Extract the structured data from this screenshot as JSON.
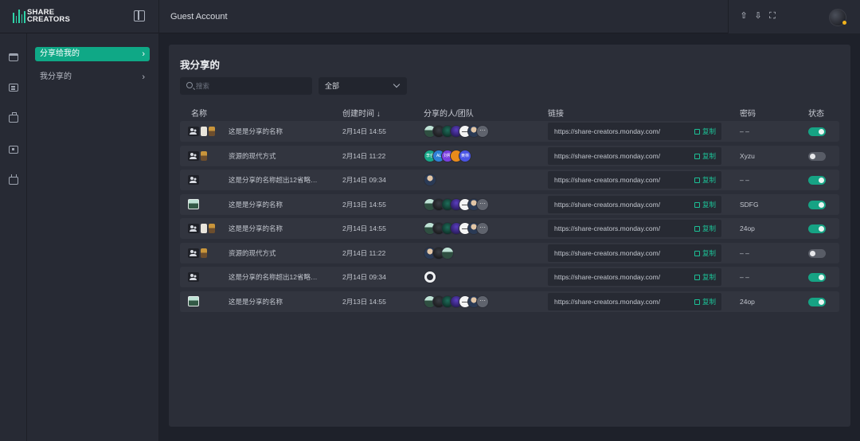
{
  "brand": {
    "line1": "SHARE",
    "line2": "CREATORS"
  },
  "header": {
    "account": "Guest Account"
  },
  "nav": {
    "items": [
      {
        "label": "分享给我的",
        "active": true
      },
      {
        "label": "我分享的",
        "active": false
      }
    ]
  },
  "main": {
    "title": "我分享的",
    "search_placeholder": "搜索",
    "filter_value": "全部",
    "columns": {
      "name": "名称",
      "created": "创建时间 ↓",
      "shared_with": "分享的人/团队",
      "link": "链接",
      "password": "密码",
      "status": "状态"
    },
    "copy_label": "复制",
    "avatar_labels": {
      "more": "···",
      "t1": "李佳",
      "t2": "AL",
      "t3": "刘明",
      "t4": "",
      "t5": "黄林"
    },
    "rows": [
      {
        "icons": [
          "team",
          "doc",
          "person"
        ],
        "name": "这是是分享的名称",
        "date": "2月14日 14:55",
        "avatars": [
          "a",
          "b",
          "c",
          "d",
          "e",
          "f",
          "more"
        ],
        "link": "https://share-creators.monday.com/",
        "password": "– –",
        "enabled": true
      },
      {
        "icons": [
          "team",
          "person"
        ],
        "name": "资源的现代方式",
        "date": "2月14日 11:22",
        "avatars": [
          "t1",
          "t2",
          "t3",
          "t4",
          "t5"
        ],
        "link": "https://share-creators.monday.com/",
        "password": "Xyzu",
        "enabled": false
      },
      {
        "icons": [
          "team"
        ],
        "name": "这是分享的名称超出12省略…",
        "date": "2月14日 09:34",
        "avatars": [
          "f"
        ],
        "link": "https://share-creators.monday.com/",
        "password": "– –",
        "enabled": true
      },
      {
        "icons": [
          "photo"
        ],
        "name": "这是是分享的名称",
        "date": "2月13日 14:55",
        "avatars": [
          "a",
          "b",
          "c",
          "d",
          "e",
          "f",
          "more"
        ],
        "link": "https://share-creators.monday.com/",
        "password": "SDFG",
        "enabled": true
      },
      {
        "icons": [
          "team",
          "doc",
          "person"
        ],
        "name": "这是是分享的名称",
        "date": "2月14日 14:55",
        "avatars": [
          "a",
          "b",
          "c",
          "d",
          "e",
          "f",
          "more"
        ],
        "link": "https://share-creators.monday.com/",
        "password": "24op",
        "enabled": true
      },
      {
        "icons": [
          "team",
          "person"
        ],
        "name": "资源的现代方式",
        "date": "2月14日 11:22",
        "avatars": [
          "f",
          "b",
          "a"
        ],
        "link": "https://share-creators.monday.com/",
        "password": "– –",
        "enabled": false
      },
      {
        "icons": [
          "team"
        ],
        "name": "这是分享的名称超出12省略…",
        "date": "2月14日 09:34",
        "avatars": [
          "gh"
        ],
        "link": "https://share-creators.monday.com/",
        "password": "– –",
        "enabled": true
      },
      {
        "icons": [
          "photo"
        ],
        "name": "这是是分享的名称",
        "date": "2月13日 14:55",
        "avatars": [
          "a",
          "b",
          "c",
          "d",
          "e",
          "f",
          "more"
        ],
        "link": "https://share-creators.monday.com/",
        "password": "24op",
        "enabled": true
      }
    ]
  },
  "icons": {
    "top_actions": [
      "upload-icon",
      "download-icon",
      "fullscreen-icon"
    ],
    "rail": [
      "folder-icon",
      "list-icon",
      "briefcase-icon",
      "card-icon",
      "gift-icon"
    ]
  },
  "colors": {
    "accent": "#0fa886",
    "toggle_on": "#16a384",
    "copy": "#1cc096"
  }
}
